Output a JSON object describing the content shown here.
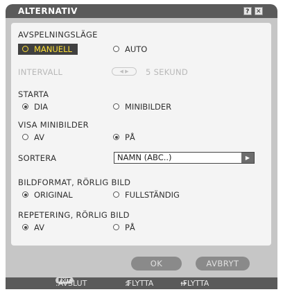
{
  "dialog": {
    "title": "ALTERNATIV"
  },
  "titlebar": {
    "help_label": "?",
    "close_label": "✕"
  },
  "playback": {
    "heading": "AVSPELNINGSLÄGE",
    "options": [
      {
        "label": "MANUELL",
        "checked": true
      },
      {
        "label": "AUTO",
        "checked": false
      }
    ]
  },
  "interval": {
    "label": "INTERVALL",
    "arrows": "◀ ▶",
    "value": "5 SEKUND"
  },
  "start": {
    "heading": "STARTA",
    "options": [
      {
        "label": "DIA",
        "checked": true
      },
      {
        "label": "MINIBILDER",
        "checked": false
      }
    ]
  },
  "show_thumbnails": {
    "heading": "VISA MINIBILDER",
    "options": [
      {
        "label": "AV",
        "checked": false
      },
      {
        "label": "PÅ",
        "checked": true
      }
    ]
  },
  "sort": {
    "label": "SORTERA",
    "value": "NAMN (ABC..)",
    "button_glyph": "▶"
  },
  "image_format": {
    "heading": "BILDFORMAT, RÖRLIG BILD",
    "options": [
      {
        "label": "ORIGINAL",
        "checked": true
      },
      {
        "label": "FULLSTÄNDIG",
        "checked": false
      }
    ]
  },
  "repeat": {
    "heading": "REPETERING, RÖRLIG BILD",
    "options": [
      {
        "label": "AV",
        "checked": true
      },
      {
        "label": "PÅ",
        "checked": false
      }
    ]
  },
  "buttons": {
    "ok": "OK",
    "cancel": "AVBRYT"
  },
  "statusbar": {
    "exit_badge": "EXIT",
    "exit_text": ":AVSLUT",
    "move_v_icon": "⇕",
    "move_v_text": ":FLYTTA",
    "move_h_icon": "↔",
    "move_h_text": ":FLYTTA"
  },
  "colors": {
    "selection_bg": "#404040",
    "selection_text": "#ffe034",
    "titlebar": "#5a5a5a",
    "dialog": "#c6c6c6"
  }
}
